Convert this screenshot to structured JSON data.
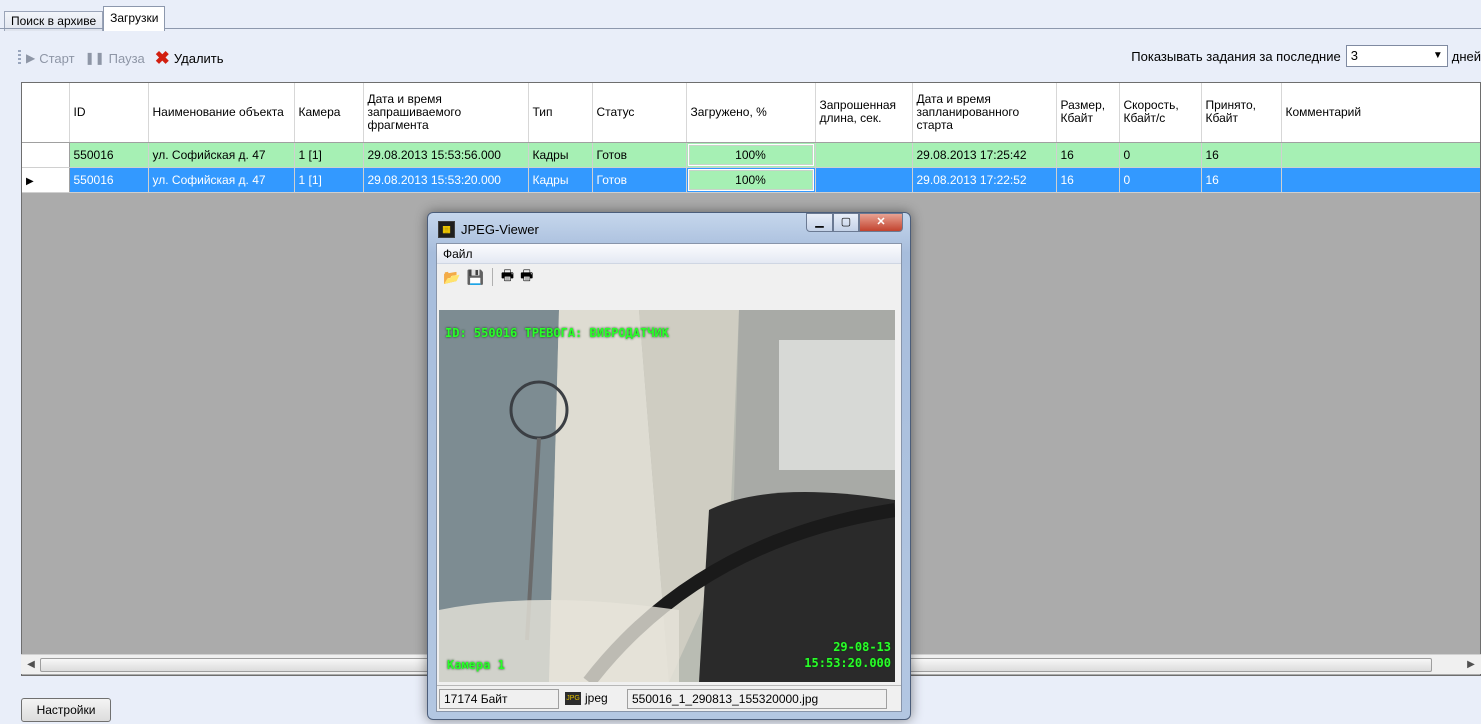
{
  "tabs": [
    {
      "label": "Поиск в архиве",
      "active": false
    },
    {
      "label": "Загрузки",
      "active": true
    }
  ],
  "toolbar": {
    "start_label": "Старт",
    "pause_label": "Пауза",
    "delete_label": "Удалить",
    "show_label": "Показывать задания за последние",
    "days_value": "3",
    "days_suffix": "дней"
  },
  "grid": {
    "columns": [
      "ID",
      "Наименование объекта",
      "Камера",
      "Дата и время запрашиваемого фрагмента",
      "Тип",
      "Статус",
      "Загружено, %",
      "Запрошенная длина, сек.",
      "Дата и время запланированного старта",
      "Размер, Кбайт",
      "Скорость, Кбайт/с",
      "Принято, Кбайт",
      "Комментарий"
    ],
    "rows": [
      {
        "id": "550016",
        "object": "ул. Софийская д. 47",
        "camera": "1 [1]",
        "fragment_time": "29.08.2013 15:53:56.000",
        "type": "Кадры",
        "status": "Готов",
        "loaded": "100%",
        "length": "",
        "planned_start": "29.08.2013 17:25:42",
        "size": "16",
        "speed": "0",
        "received": "16",
        "comment": ""
      },
      {
        "id": "550016",
        "object": "ул. Софийская д. 47",
        "camera": "1 [1]",
        "fragment_time": "29.08.2013 15:53:20.000",
        "type": "Кадры",
        "status": "Готов",
        "loaded": "100%",
        "length": "",
        "planned_start": "29.08.2013 17:22:52",
        "size": "16",
        "speed": "0",
        "received": "16",
        "comment": ""
      }
    ]
  },
  "settings_label": "Настройки",
  "viewer": {
    "title": "JPEG-Viewer",
    "menu_file": "Файл",
    "overlay_top": "ID: 550016  ТРЕВОГА: ВИБРОДАТЧИК",
    "overlay_date": "29-08-13",
    "overlay_time": "15:53:20.000",
    "overlay_camera": "Камера 1",
    "status_size": "17174 Байт",
    "status_format": "jpeg",
    "status_file": "550016_1_290813_155320000.jpg"
  },
  "colors": {
    "row_ok": "#a6f0b4",
    "row_selected": "#3399ff",
    "overlay_text": "#28ff28"
  }
}
